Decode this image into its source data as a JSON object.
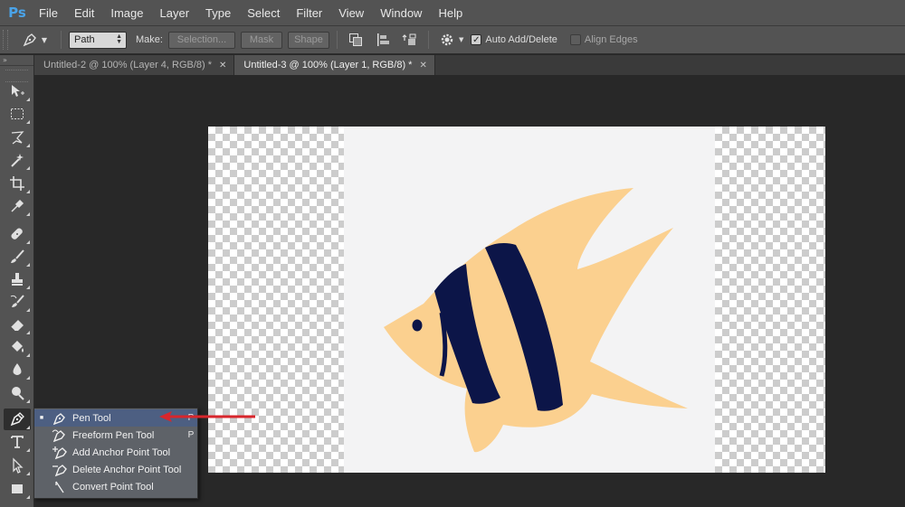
{
  "app": {
    "logo": "Ps"
  },
  "menu": [
    "File",
    "Edit",
    "Image",
    "Layer",
    "Type",
    "Select",
    "Filter",
    "View",
    "Window",
    "Help"
  ],
  "options": {
    "mode_value": "Path",
    "make_label": "Make:",
    "selection_label": "Selection...",
    "mask_label": "Mask",
    "shape_label": "Shape",
    "auto_add_delete_label": "Auto Add/Delete",
    "auto_add_delete_checked": true,
    "align_edges_label": "Align Edges",
    "align_edges_checked": false
  },
  "tabs": [
    {
      "title": "Untitled-2 @ 100% (Layer 4, RGB/8) *",
      "active": false
    },
    {
      "title": "Untitled-3 @ 100% (Layer 1, RGB/8) *",
      "active": true
    }
  ],
  "toolbar": {
    "tools": [
      "move-icon",
      "marquee-icon",
      "lasso-icon",
      "magic-wand-icon",
      "crop-icon",
      "eyedropper-icon",
      "healing-brush-icon",
      "brush-icon",
      "clone-stamp-icon",
      "history-brush-icon",
      "eraser-icon",
      "paint-bucket-icon",
      "blur-icon",
      "dodge-icon",
      "pen-icon",
      "type-icon",
      "path-selection-icon",
      "rectangle-icon"
    ],
    "active_tool": "pen-icon"
  },
  "flyout": {
    "items": [
      {
        "label": "Pen Tool",
        "shortcut": "P",
        "icon": "pen-icon",
        "selected": true
      },
      {
        "label": "Freeform Pen Tool",
        "shortcut": "P",
        "icon": "freeform-pen-icon",
        "selected": false
      },
      {
        "label": "Add Anchor Point Tool",
        "shortcut": "",
        "icon": "add-anchor-point-icon",
        "selected": false
      },
      {
        "label": "Delete Anchor Point Tool",
        "shortcut": "",
        "icon": "delete-anchor-point-icon",
        "selected": false
      },
      {
        "label": "Convert Point Tool",
        "shortcut": "",
        "icon": "convert-point-icon",
        "selected": false
      }
    ]
  },
  "colors": {
    "fish_body": "#fbd08f",
    "fish_stripes": "#0c1548",
    "artboard": "#f3f3f4",
    "arrow": "#d8262c",
    "flyout_highlight": "#4d5f82"
  }
}
